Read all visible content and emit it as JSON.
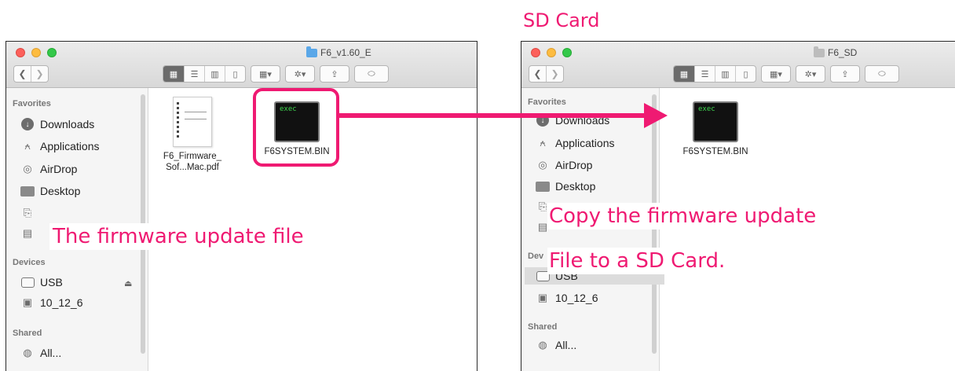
{
  "annotations": {
    "sd_title": "SD Card",
    "left_caption": "The firmware update file",
    "right_caption_line1": "Copy the firmware update",
    "right_caption_line2": "File to a SD Card.",
    "accent_color": "#ef1a72"
  },
  "left_window": {
    "title": "F6_v1.60_E",
    "sidebar": {
      "favorites_header": "Favorites",
      "favorites": [
        {
          "label": "Downloads",
          "icon": "downloads-icon"
        },
        {
          "label": "Applications",
          "icon": "applications-icon"
        },
        {
          "label": "AirDrop",
          "icon": "airdrop-icon"
        },
        {
          "label": "Desktop",
          "icon": "desktop-icon"
        }
      ],
      "devices_header": "Devices",
      "devices": [
        {
          "label": "USB",
          "icon": "drive-icon"
        },
        {
          "label": "10_12_6",
          "icon": "disk-image-icon"
        }
      ],
      "shared_header": "Shared",
      "shared": [
        {
          "label": "All...",
          "icon": "network-icon"
        }
      ]
    },
    "files": [
      {
        "label": "F6_Firmware_\nSof...Mac.pdf",
        "icon": "pdf-document-icon"
      },
      {
        "label": "F6SYSTEM.BIN",
        "icon": "exec-icon",
        "icon_text": "exec"
      }
    ]
  },
  "right_window": {
    "title": "F6_SD",
    "sidebar": {
      "favorites_header": "Favorites",
      "favorites": [
        {
          "label": "Downloads",
          "icon": "downloads-icon"
        },
        {
          "label": "Applications",
          "icon": "applications-icon"
        },
        {
          "label": "AirDrop",
          "icon": "airdrop-icon"
        },
        {
          "label": "Desktop",
          "icon": "desktop-icon"
        }
      ],
      "devices_header": "Dev",
      "devices": [
        {
          "label": "USB",
          "icon": "drive-icon"
        },
        {
          "label": "10_12_6",
          "icon": "disk-image-icon"
        }
      ],
      "shared_header": "Shared",
      "shared": [
        {
          "label": "All...",
          "icon": "network-icon"
        }
      ]
    },
    "files": [
      {
        "label": "F6SYSTEM.BIN",
        "icon": "exec-icon",
        "icon_text": "exec"
      }
    ]
  }
}
